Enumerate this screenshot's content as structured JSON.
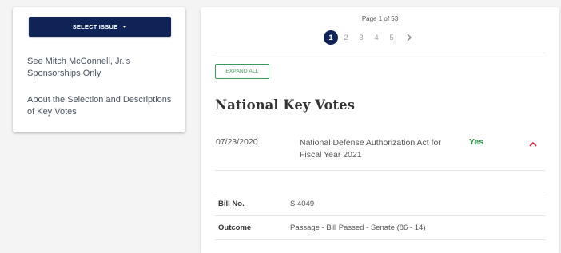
{
  "sidebar": {
    "select_issue_label": "SELECT ISSUE",
    "links": [
      "See Mitch McConnell, Jr.'s Sponsorships Only",
      "About the Selection and Descriptions of Key Votes"
    ]
  },
  "pagination": {
    "label": "Page 1 of 53",
    "pages": [
      "1",
      "2",
      "3",
      "4",
      "5"
    ],
    "current": "1",
    "next_icon": "chevron-right-icon"
  },
  "expand_all_label": "EXPAND ALL",
  "section_title": "National Key Votes",
  "vote": {
    "date": "07/23/2020",
    "title": "National Defense Authorization Act for Fiscal Year 2021",
    "result": "Yes",
    "toggle_icon": "chevron-up-icon",
    "details": [
      {
        "label": "Bill No.",
        "value": "S 4049"
      },
      {
        "label": "Outcome",
        "value": "Passage - Bill Passed - Senate (86 - 14)"
      }
    ]
  },
  "colors": {
    "navy": "#0f2356",
    "green": "#3a9b54",
    "chevron_red": "#d0283a"
  }
}
